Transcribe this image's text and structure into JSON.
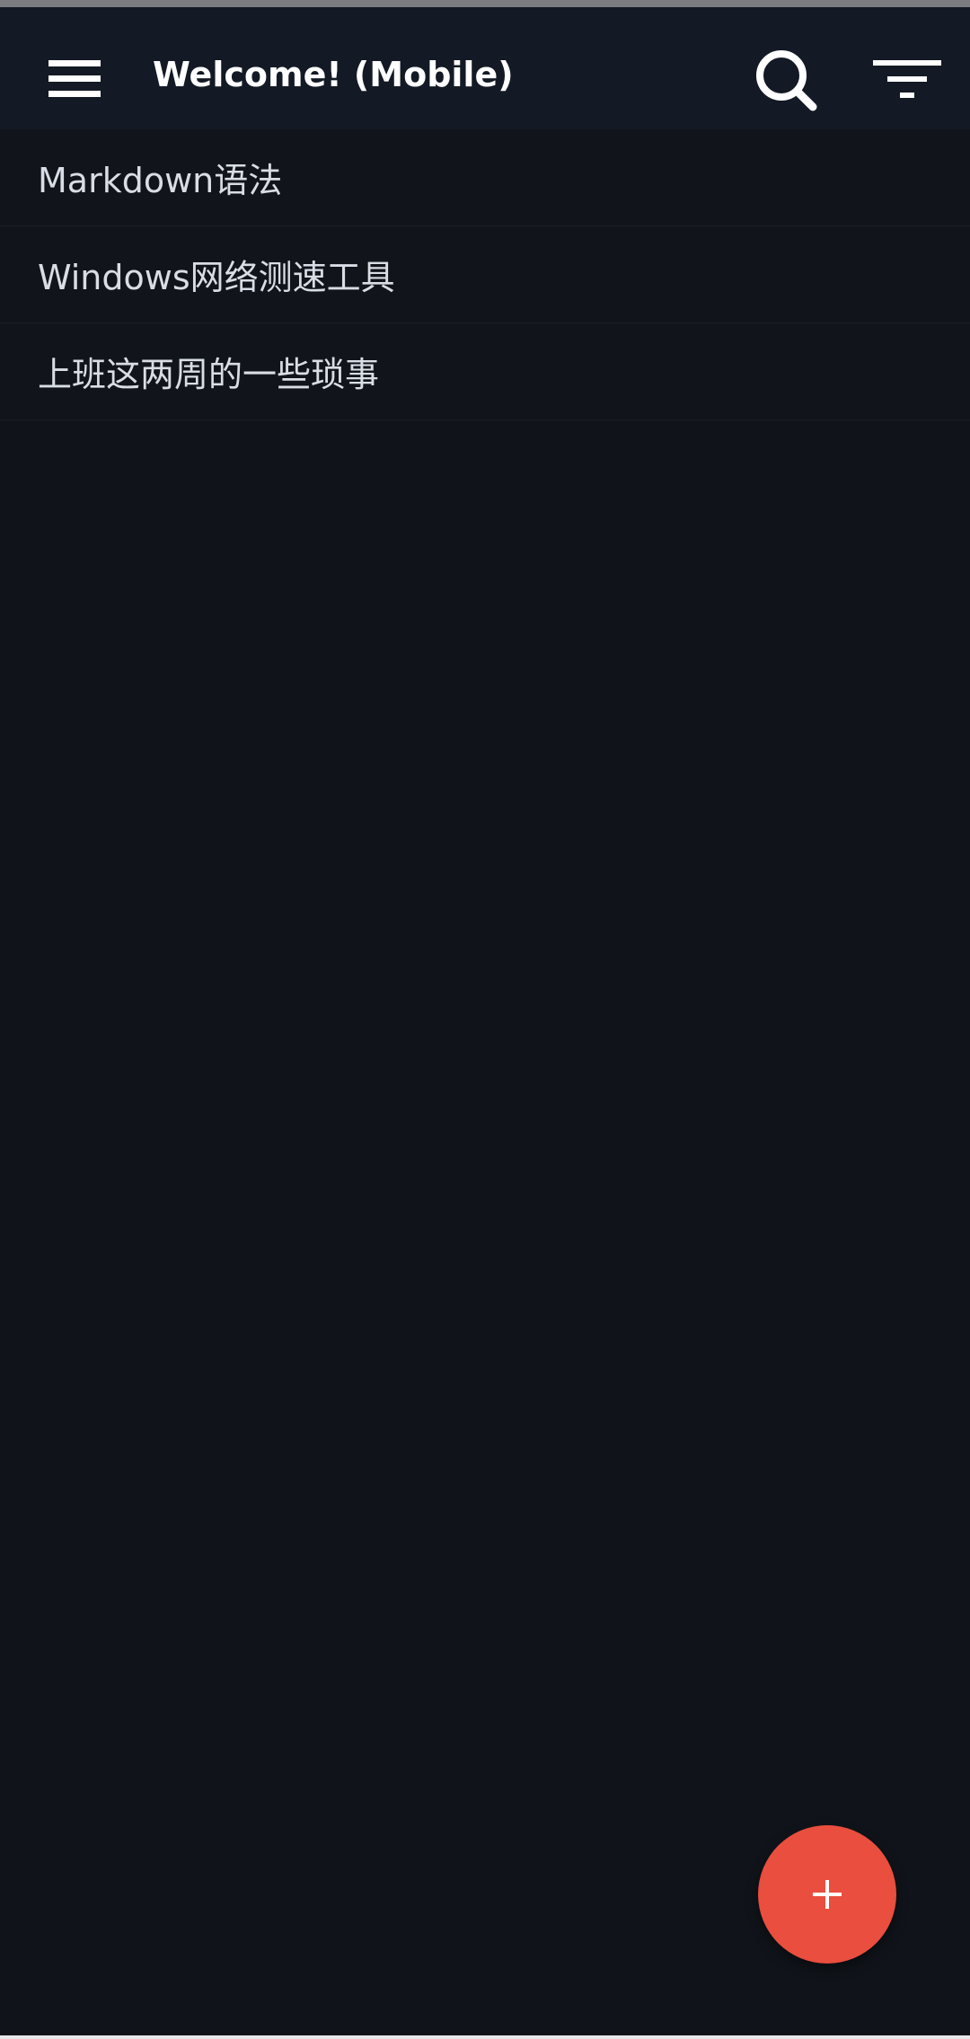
{
  "app_bar": {
    "title": "Welcome! (Mobile)",
    "icons": {
      "menu": "hamburger-menu-icon",
      "search": "search-icon",
      "filter": "filter-icon"
    }
  },
  "notes": [
    {
      "title": "Markdown语法"
    },
    {
      "title": "Windows网络测速工具"
    },
    {
      "title": "上班这两周的一些琐事"
    }
  ],
  "fab": {
    "icon": "plus-icon"
  },
  "colors": {
    "background": "#10141a",
    "app_bar": "#131a25",
    "accent": "#e94e3e",
    "text": "#d8dde6"
  }
}
